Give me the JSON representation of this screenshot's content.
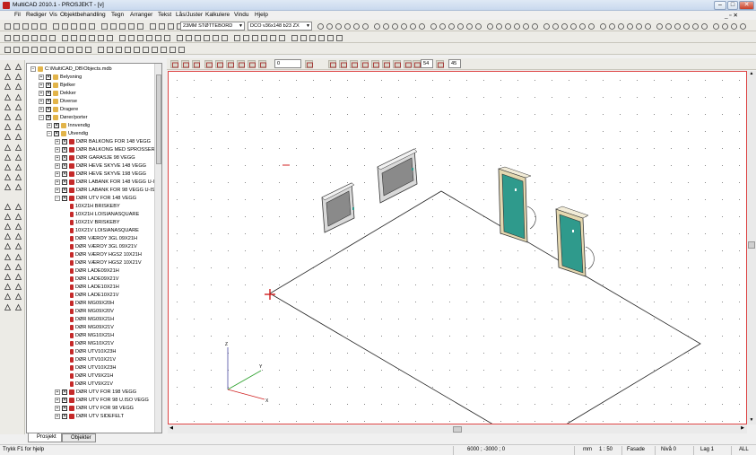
{
  "window": {
    "title": "MultiCAD 2010.1 - PROSJEKT - [v]",
    "controls": [
      "–",
      "□",
      "✕"
    ]
  },
  "menu": [
    "Fil",
    "Rediger",
    "Vis",
    "Objektbehandling",
    "Tegn",
    "Arranger",
    "Tekst",
    "Lås/Juster",
    "Kalkulere",
    "Vindu",
    "Hjelp"
  ],
  "toolbar": {
    "layer_select": "23MM STØTTEBORD",
    "object_select": "DCO v36x148 b23 ZX"
  },
  "view_toolbar": {
    "angle_value": "0",
    "field1": "54",
    "field2": "45"
  },
  "tree": {
    "root": "C:\\MultiCAD_DB\\Objects.mdb",
    "categories": [
      "Belysning",
      "Bjelker",
      "Dekker",
      "Diverse",
      "Dragere",
      "Dører/porter"
    ],
    "sub_doors": [
      "Innvendig",
      "Utvendig"
    ],
    "outer_groups_top": [
      "DØR BALKONG FOR 148 VEGG",
      "DØR BALKONG MED SPROSSER",
      "DØR GARASJE 98 VEGG",
      "DØR HEVE SKYVE 148 VEGG",
      "DØR HEVE SKYVE 198 VEGG",
      "DØR LABANK FOR 148 VEGG U-ISO",
      "DØR LABANK FOR 98 VEGG U-ISO",
      "DØR UTV FOR 148 VEGG"
    ],
    "items": [
      "10X21H BRISKEBY",
      "10X21H LOISIANASQUARE",
      "10X21V BRISKEBY",
      "10X21V LOISIANASQUARE",
      "DØR VÆROY 3GL 09X21H",
      "DØR VÆROY 3GL 09X21V",
      "DØR VÆROY HGS2 10X21H",
      "DØR VÆROY HGS2 10X21V",
      "DØR LADE09X21H",
      "DØR LADE09X21V",
      "DØR LADE10X21H",
      "DØR LADE10X21V",
      "DØR MG09X20H",
      "DØR MG09X20V",
      "DØR MG09X21H",
      "DØR MG09X21V",
      "DØR MG10X21H",
      "DØR MG10X21V",
      "DØR UTV10X23H",
      "DØR UTV10X21V",
      "DØR UTV10X23H",
      "DØR UTV9X21H",
      "DØR UTV9X21V"
    ],
    "outer_groups_bottom": [
      "DØR UTV FOR 198 VEGG",
      "DØR UTV FOR 98 U.ISO VEGG",
      "DØR UTV FOR 98 VEGG",
      "DØR UTV SIDEFELT"
    ]
  },
  "tabs": [
    "Prosjekt",
    "Objekter"
  ],
  "canvas": {
    "axis_labels": [
      "Z",
      "Y",
      "X"
    ]
  },
  "status": {
    "help": "Trykk F1 for hjelp",
    "coords": "6000 ; -3000 ; 0",
    "unit": "mm",
    "scale": "1 : 50",
    "view": "Fasade",
    "level": "Nivå 0",
    "layer": "Lag 1",
    "mode": "ALL"
  },
  "colors": {
    "door_panel": "#2f9a8c",
    "door_frame": "#e4d8b0",
    "window_glass": "#8a8a8a",
    "canvas_border": "#dd4444"
  }
}
